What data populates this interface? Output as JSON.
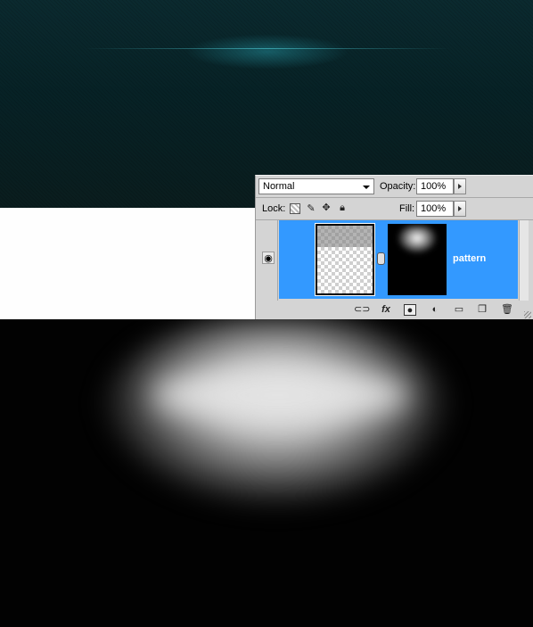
{
  "layers_panel": {
    "blend_mode": "Normal",
    "opacity_label": "Opacity:",
    "opacity_value": "100%",
    "lock_label": "Lock:",
    "fill_label": "Fill:",
    "fill_value": "100%",
    "layer": {
      "name": "pattern",
      "visible": true,
      "selected_color": "#3399ff"
    },
    "footer_icons": [
      "link-icon",
      "fx-icon",
      "add-mask-icon",
      "adjustment-icon",
      "new-group-icon",
      "new-layer-icon",
      "trash-icon"
    ],
    "fx_label": "fx"
  },
  "colors": {
    "canvas_top": "#0a2529",
    "canvas_bottom": "#020202",
    "white_area": "#fefefe",
    "panel_bg": "#d4d4d4"
  }
}
